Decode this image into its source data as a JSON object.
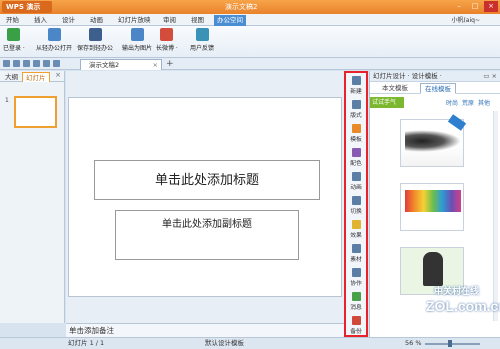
{
  "titlebar": {
    "app_name": "WPS 演示",
    "doc_title": "演示文稿2"
  },
  "menu": {
    "tabs": [
      "开始",
      "插入",
      "设计",
      "动画",
      "幻灯片放映",
      "审阅",
      "视图",
      "办公空间"
    ],
    "active": "办公空间",
    "user": "小帆(aiq~"
  },
  "ribbon": {
    "buttons": [
      {
        "label": "已登录 ·",
        "icon": "login-icon"
      },
      {
        "label": "从轻办公打开",
        "icon": "open-cloud-icon"
      },
      {
        "label": "保存到轻办公",
        "icon": "save-cloud-icon"
      },
      {
        "label": "输出为图片",
        "icon": "export-image-icon"
      },
      {
        "label": "长微博 ·",
        "icon": "weibo-icon"
      },
      {
        "label": "用户反馈",
        "icon": "feedback-icon"
      }
    ]
  },
  "doc_tab": {
    "title": "演示文稿2",
    "add": "+"
  },
  "left_pane": {
    "tab_outline": "大纲",
    "tab_slides": "幻灯片",
    "close": "×",
    "slide_number": "1"
  },
  "slide": {
    "title_placeholder": "单击此处添加标题",
    "subtitle_placeholder": "单击此处添加副标题"
  },
  "notes": {
    "placeholder": "单击添加备注"
  },
  "sidebar": {
    "items": [
      "新建",
      "版式",
      "模板",
      "配色",
      "动画",
      "切换",
      "效果",
      "素材",
      "协作",
      "消息",
      "备份"
    ]
  },
  "right_panel": {
    "header": "幻灯片设计 · 设计模板 ·",
    "tabs": [
      "本文模板",
      "在线模板"
    ],
    "active_tab": "在线模板",
    "filter_green": "试试手气",
    "filters": [
      "时尚",
      "荒原",
      "其他"
    ]
  },
  "statusbar": {
    "slide_info": "幻灯片 1 / 1",
    "template": "默认设计模板",
    "zoom": "56 %"
  },
  "watermark": {
    "line1": "中关村在线",
    "line2": "ZOL.com.cn"
  }
}
